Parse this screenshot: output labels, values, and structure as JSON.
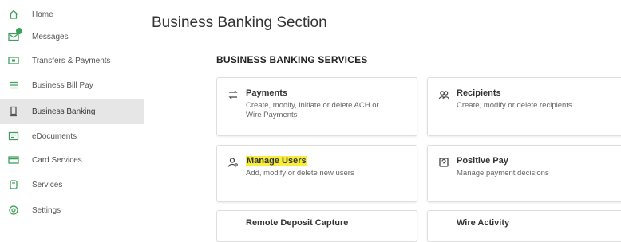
{
  "sidebar": {
    "items": [
      {
        "label": "Home",
        "icon": "home-icon"
      },
      {
        "label": "Messages",
        "icon": "messages-icon"
      },
      {
        "label": "Transfers & Payments",
        "icon": "transfers-icon"
      },
      {
        "label": "Business Bill Pay",
        "icon": "bill-pay-icon"
      },
      {
        "label": "Business Banking",
        "icon": "business-banking-icon",
        "active": true
      },
      {
        "label": "eDocuments",
        "icon": "edocuments-icon"
      },
      {
        "label": "Card Services",
        "icon": "card-icon"
      },
      {
        "label": "Services",
        "icon": "services-icon"
      },
      {
        "label": "Settings",
        "icon": "settings-icon"
      }
    ]
  },
  "main": {
    "title": "Business Banking Section",
    "section_heading": "BUSINESS BANKING SERVICES",
    "cards": [
      {
        "title": "Payments",
        "description": "Create, modify, initiate or delete ACH or Wire Payments",
        "icon": "payments-icon"
      },
      {
        "title": "Recipients",
        "description": "Create, modify or delete recipients",
        "icon": "recipients-icon"
      },
      {
        "title": "Manage Users",
        "description": "Add, modify or delete new users",
        "icon": "user-icon",
        "highlighted": true
      },
      {
        "title": "Positive Pay",
        "description": "Manage payment decisions",
        "icon": "positive-pay-icon"
      },
      {
        "title": "Remote Deposit Capture",
        "description": "",
        "icon": ""
      },
      {
        "title": "Wire Activity",
        "description": "",
        "icon": ""
      }
    ]
  },
  "colors": {
    "accent": "#3f9e5c",
    "highlight": "#f6ee3a",
    "active_bg": "#e6e6e6"
  }
}
